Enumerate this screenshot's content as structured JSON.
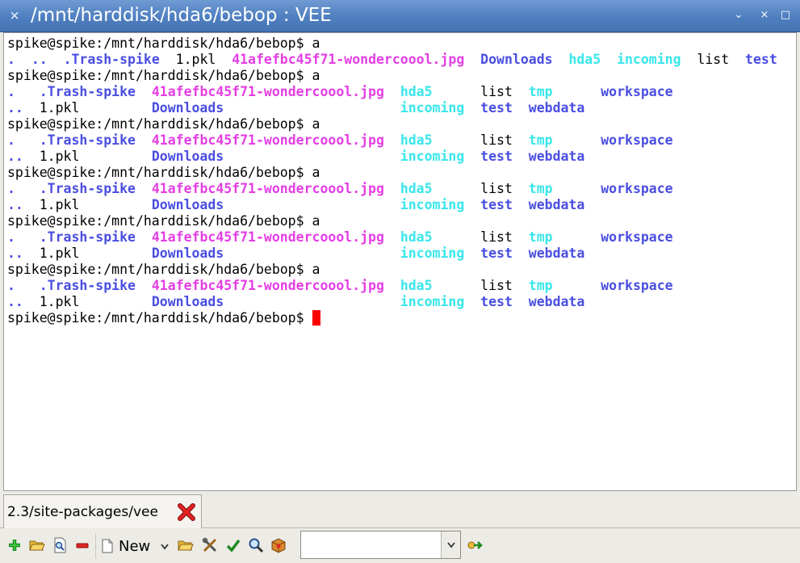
{
  "window": {
    "title": "/mnt/harddisk/hda6/bebop : VEE",
    "close_glyph": "×",
    "minimize_glyph": "⌄",
    "maximize_glyph": "×",
    "restore_glyph": "□"
  },
  "terminal": {
    "lines": [
      [
        {
          "t": "spike@spike:/mnt/harddisk/hda6/bebop$ a",
          "c": "plain"
        }
      ],
      [
        {
          "t": ".",
          "c": "dir"
        },
        {
          "t": "  ",
          "c": "plain"
        },
        {
          "t": "..",
          "c": "dir"
        },
        {
          "t": "  ",
          "c": "plain"
        },
        {
          "t": ".Trash-spike",
          "c": "dir"
        },
        {
          "t": "  1.pkl  ",
          "c": "plain"
        },
        {
          "t": "41afefbc45f71-wondercoool.jpg",
          "c": "img"
        },
        {
          "t": "  ",
          "c": "plain"
        },
        {
          "t": "Downloads",
          "c": "dir"
        },
        {
          "t": "  ",
          "c": "plain"
        },
        {
          "t": "hda5",
          "c": "lnk"
        },
        {
          "t": "  ",
          "c": "plain"
        },
        {
          "t": "incoming",
          "c": "lnk"
        },
        {
          "t": "  list  ",
          "c": "plain"
        },
        {
          "t": "test",
          "c": "dir"
        }
      ],
      [
        {
          "t": "spike@spike:/mnt/harddisk/hda6/bebop$ a",
          "c": "plain"
        }
      ],
      [
        {
          "t": ".",
          "c": "dir"
        },
        {
          "t": "   ",
          "c": "plain"
        },
        {
          "t": ".Trash-spike",
          "c": "dir"
        },
        {
          "t": "  ",
          "c": "plain"
        },
        {
          "t": "41afefbc45f71-wondercoool.jpg",
          "c": "img"
        },
        {
          "t": "  ",
          "c": "plain"
        },
        {
          "t": "hda5",
          "c": "lnk"
        },
        {
          "t": "      list  ",
          "c": "plain"
        },
        {
          "t": "tmp",
          "c": "lnk"
        },
        {
          "t": "      ",
          "c": "plain"
        },
        {
          "t": "workspace",
          "c": "dir"
        }
      ],
      [
        {
          "t": "..",
          "c": "dir"
        },
        {
          "t": "  1.pkl         ",
          "c": "plain"
        },
        {
          "t": "Downloads",
          "c": "dir"
        },
        {
          "t": "                      ",
          "c": "plain"
        },
        {
          "t": "incoming",
          "c": "lnk"
        },
        {
          "t": "  ",
          "c": "plain"
        },
        {
          "t": "test",
          "c": "dir"
        },
        {
          "t": "  ",
          "c": "plain"
        },
        {
          "t": "webdata",
          "c": "dir"
        }
      ],
      [
        {
          "t": "spike@spike:/mnt/harddisk/hda6/bebop$ a",
          "c": "plain"
        }
      ],
      [
        {
          "t": ".",
          "c": "dir"
        },
        {
          "t": "   ",
          "c": "plain"
        },
        {
          "t": ".Trash-spike",
          "c": "dir"
        },
        {
          "t": "  ",
          "c": "plain"
        },
        {
          "t": "41afefbc45f71-wondercoool.jpg",
          "c": "img"
        },
        {
          "t": "  ",
          "c": "plain"
        },
        {
          "t": "hda5",
          "c": "lnk"
        },
        {
          "t": "      list  ",
          "c": "plain"
        },
        {
          "t": "tmp",
          "c": "lnk"
        },
        {
          "t": "      ",
          "c": "plain"
        },
        {
          "t": "workspace",
          "c": "dir"
        }
      ],
      [
        {
          "t": "..",
          "c": "dir"
        },
        {
          "t": "  1.pkl         ",
          "c": "plain"
        },
        {
          "t": "Downloads",
          "c": "dir"
        },
        {
          "t": "                      ",
          "c": "plain"
        },
        {
          "t": "incoming",
          "c": "lnk"
        },
        {
          "t": "  ",
          "c": "plain"
        },
        {
          "t": "test",
          "c": "dir"
        },
        {
          "t": "  ",
          "c": "plain"
        },
        {
          "t": "webdata",
          "c": "dir"
        }
      ],
      [
        {
          "t": "spike@spike:/mnt/harddisk/hda6/bebop$ a",
          "c": "plain"
        }
      ],
      [
        {
          "t": ".",
          "c": "dir"
        },
        {
          "t": "   ",
          "c": "plain"
        },
        {
          "t": ".Trash-spike",
          "c": "dir"
        },
        {
          "t": "  ",
          "c": "plain"
        },
        {
          "t": "41afefbc45f71-wondercoool.jpg",
          "c": "img"
        },
        {
          "t": "  ",
          "c": "plain"
        },
        {
          "t": "hda5",
          "c": "lnk"
        },
        {
          "t": "      list  ",
          "c": "plain"
        },
        {
          "t": "tmp",
          "c": "lnk"
        },
        {
          "t": "      ",
          "c": "plain"
        },
        {
          "t": "workspace",
          "c": "dir"
        }
      ],
      [
        {
          "t": "..",
          "c": "dir"
        },
        {
          "t": "  1.pkl         ",
          "c": "plain"
        },
        {
          "t": "Downloads",
          "c": "dir"
        },
        {
          "t": "                      ",
          "c": "plain"
        },
        {
          "t": "incoming",
          "c": "lnk"
        },
        {
          "t": "  ",
          "c": "plain"
        },
        {
          "t": "test",
          "c": "dir"
        },
        {
          "t": "  ",
          "c": "plain"
        },
        {
          "t": "webdata",
          "c": "dir"
        }
      ],
      [
        {
          "t": "spike@spike:/mnt/harddisk/hda6/bebop$ a",
          "c": "plain"
        }
      ],
      [
        {
          "t": ".",
          "c": "dir"
        },
        {
          "t": "   ",
          "c": "plain"
        },
        {
          "t": ".Trash-spike",
          "c": "dir"
        },
        {
          "t": "  ",
          "c": "plain"
        },
        {
          "t": "41afefbc45f71-wondercoool.jpg",
          "c": "img"
        },
        {
          "t": "  ",
          "c": "plain"
        },
        {
          "t": "hda5",
          "c": "lnk"
        },
        {
          "t": "      list  ",
          "c": "plain"
        },
        {
          "t": "tmp",
          "c": "lnk"
        },
        {
          "t": "      ",
          "c": "plain"
        },
        {
          "t": "workspace",
          "c": "dir"
        }
      ],
      [
        {
          "t": "..",
          "c": "dir"
        },
        {
          "t": "  1.pkl         ",
          "c": "plain"
        },
        {
          "t": "Downloads",
          "c": "dir"
        },
        {
          "t": "                      ",
          "c": "plain"
        },
        {
          "t": "incoming",
          "c": "lnk"
        },
        {
          "t": "  ",
          "c": "plain"
        },
        {
          "t": "test",
          "c": "dir"
        },
        {
          "t": "  ",
          "c": "plain"
        },
        {
          "t": "webdata",
          "c": "dir"
        }
      ],
      [
        {
          "t": "spike@spike:/mnt/harddisk/hda6/bebop$ a",
          "c": "plain"
        }
      ],
      [
        {
          "t": ".",
          "c": "dir"
        },
        {
          "t": "   ",
          "c": "plain"
        },
        {
          "t": ".Trash-spike",
          "c": "dir"
        },
        {
          "t": "  ",
          "c": "plain"
        },
        {
          "t": "41afefbc45f71-wondercoool.jpg",
          "c": "img"
        },
        {
          "t": "  ",
          "c": "plain"
        },
        {
          "t": "hda5",
          "c": "lnk"
        },
        {
          "t": "      list  ",
          "c": "plain"
        },
        {
          "t": "tmp",
          "c": "lnk"
        },
        {
          "t": "      ",
          "c": "plain"
        },
        {
          "t": "workspace",
          "c": "dir"
        }
      ],
      [
        {
          "t": "..",
          "c": "dir"
        },
        {
          "t": "  1.pkl         ",
          "c": "plain"
        },
        {
          "t": "Downloads",
          "c": "dir"
        },
        {
          "t": "                      ",
          "c": "plain"
        },
        {
          "t": "incoming",
          "c": "lnk"
        },
        {
          "t": "  ",
          "c": "plain"
        },
        {
          "t": "test",
          "c": "dir"
        },
        {
          "t": "  ",
          "c": "plain"
        },
        {
          "t": "webdata",
          "c": "dir"
        }
      ]
    ],
    "prompt": "spike@spike:/mnt/harddisk/hda6/bebop$ "
  },
  "tabs": [
    {
      "label": "2.3/site-packages/vee"
    }
  ],
  "toolbar": {
    "new_label": "New",
    "combo_value": "",
    "icons": [
      "add-icon",
      "open-folder-icon",
      "find-file-icon",
      "remove-icon",
      "new-document-icon",
      "folder-icon",
      "tools-icon",
      "check-icon",
      "zoom-icon",
      "package-icon",
      "go-icon"
    ]
  },
  "colors": {
    "dir": "#4a4ee0",
    "image": "#e43ee4",
    "link": "#38e6ea",
    "cursor": "#ff0000",
    "titlebar": "#5686c6"
  }
}
